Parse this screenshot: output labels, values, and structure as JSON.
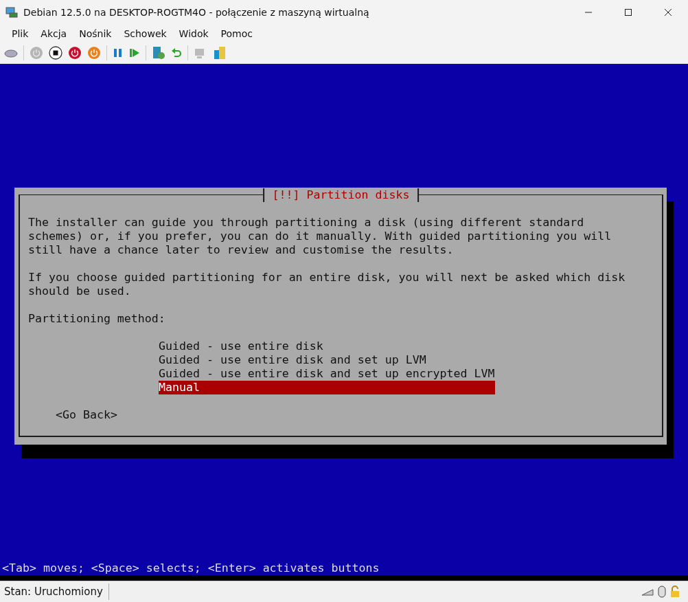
{
  "window": {
    "title": "Debian 12.5.0 na DESKTOP-ROGTM4O - połączenie z maszyną wirtualną"
  },
  "menu": [
    "Plik",
    "Akcja",
    "Nośnik",
    "Schowek",
    "Widok",
    "Pomoc"
  ],
  "dialog": {
    "title": "[!!] Partition disks",
    "paragraphs": [
      "The installer can guide you through partitioning a disk (using different standard\nschemes) or, if you prefer, you can do it manually. With guided partitioning you will\nstill have a chance later to review and customise the results.",
      "If you choose guided partitioning for an entire disk, you will next be asked which disk\nshould be used.",
      "Partitioning method:"
    ],
    "options": [
      {
        "label": "Guided - use entire disk",
        "selected": false
      },
      {
        "label": "Guided - use entire disk and set up LVM",
        "selected": false
      },
      {
        "label": "Guided - use entire disk and set up encrypted LVM",
        "selected": false
      },
      {
        "label": "Manual",
        "selected": true
      }
    ],
    "back_button": "<Go Back>"
  },
  "hint": "<Tab> moves; <Space> selects; <Enter> activates buttons",
  "status_bar": {
    "text": "Stan: Uruchomiony"
  }
}
